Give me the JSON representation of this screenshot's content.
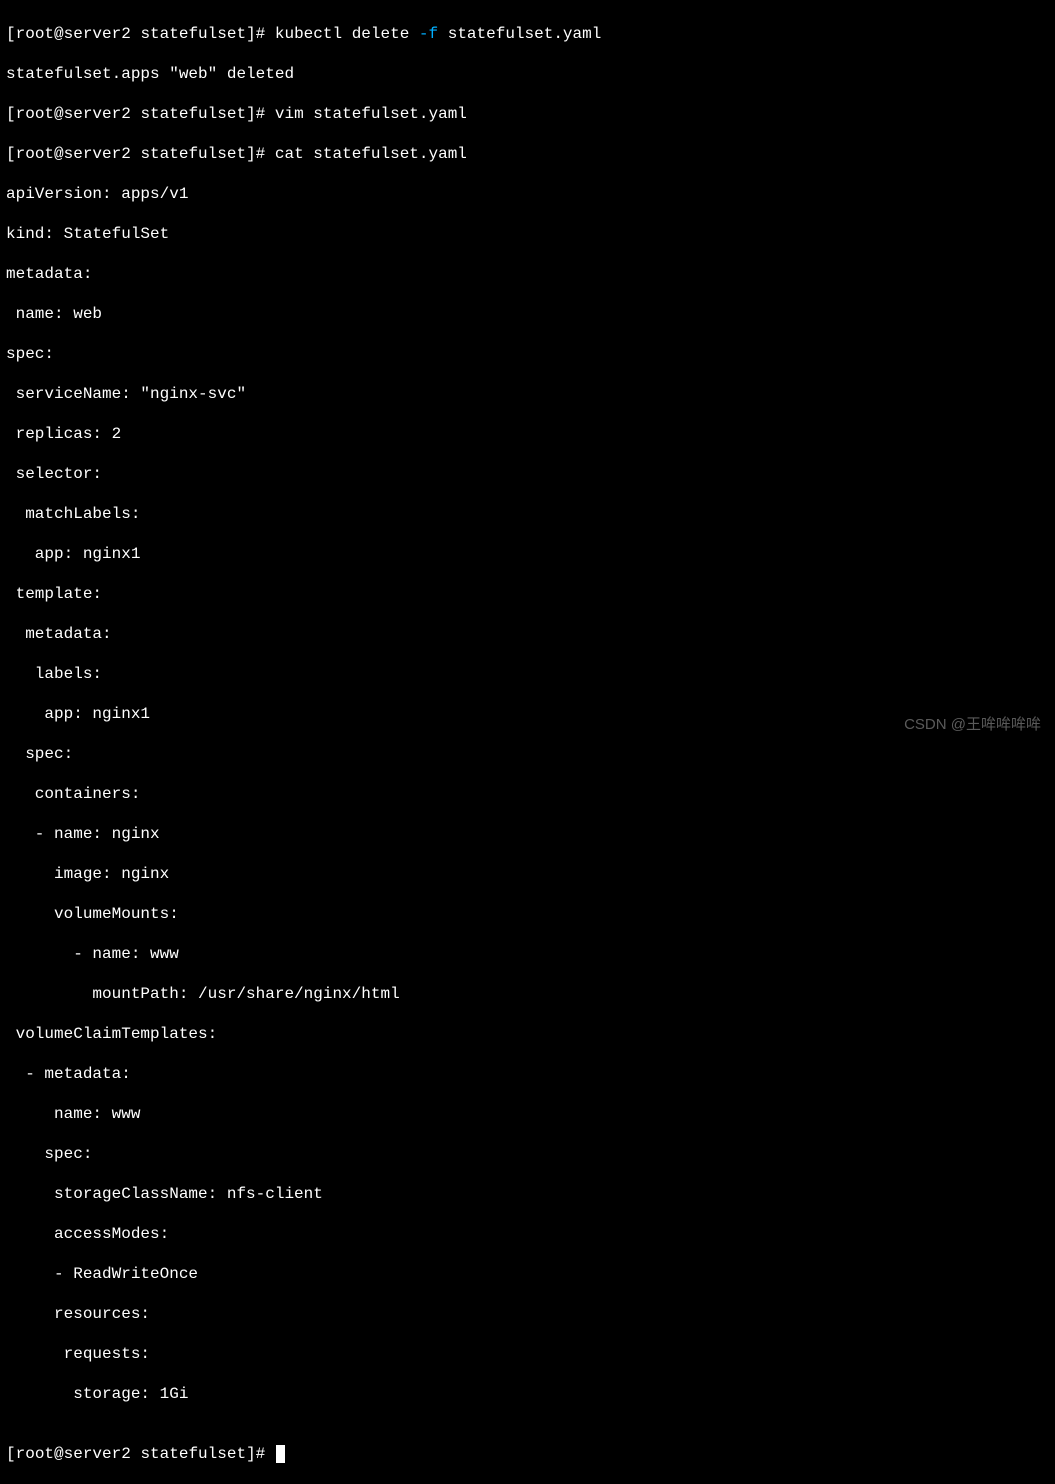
{
  "prompt": {
    "user_host": "root@server2",
    "directory": "statefulset",
    "open_bracket": "[",
    "close_bracket": "]#"
  },
  "cmd1": "kubectl delete ",
  "cmd1_flag": "-f",
  "cmd1_rest": " statefulset.yaml",
  "out1": "statefulset.apps \"web\" deleted",
  "cmd2": "vim statefulset.yaml",
  "cmd3": "cat statefulset.yaml",
  "yaml": {
    "l01": "apiVersion: apps/v1",
    "l02": "kind: StatefulSet",
    "l03": "metadata:",
    "l04": " name: web",
    "l05": "spec:",
    "l06": " serviceName: \"nginx-svc\"",
    "l07": " replicas: 2",
    "l08": " selector:",
    "l09": "  matchLabels:",
    "l10": "   app: nginx1",
    "l11": " template:",
    "l12": "  metadata:",
    "l13": "   labels:",
    "l14": "    app: nginx1",
    "l15": "  spec:",
    "l16": "   containers:",
    "l17": "   - name: nginx",
    "l18": "     image: nginx",
    "l19": "     volumeMounts:",
    "l20": "       - name: www",
    "l21": "         mountPath: /usr/share/nginx/html",
    "l22": " volumeClaimTemplates:",
    "l23": "  - metadata:",
    "l24": "     name: www",
    "l25": "    spec:",
    "l26": "     storageClassName: nfs-client",
    "l27": "     accessModes:",
    "l28": "     - ReadWriteOnce",
    "l29": "     resources:",
    "l30": "      requests:",
    "l31": "       storage: 1Gi"
  },
  "blank": "",
  "watermark": "CSDN @王哞哞哞哞"
}
